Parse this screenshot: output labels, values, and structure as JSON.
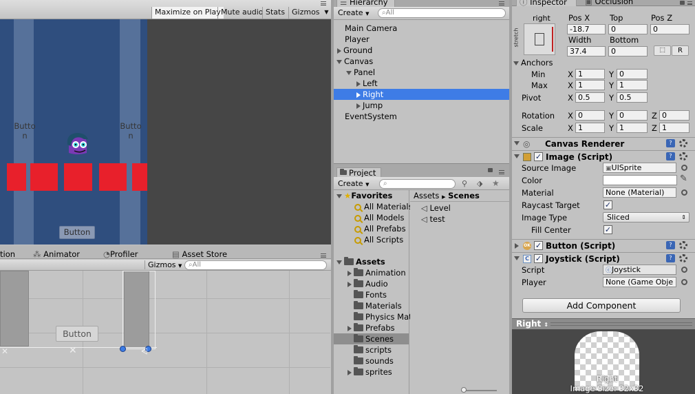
{
  "game_toolbar": {
    "maximize": "Maximize on Play",
    "mute": "Mute audio",
    "stats": "Stats",
    "gizmos": "Gizmos"
  },
  "game_view": {
    "left_button": "Butto\nn",
    "right_button": "Butto\nn",
    "bottom_button": "Button"
  },
  "scene_tabs": {
    "partial": "tion",
    "animator": "Animator",
    "profiler": "Profiler",
    "asset_store": "Asset Store",
    "gizmos": "Gizmos",
    "search_placeholder": "All"
  },
  "scene_view": {
    "button_label": "Button"
  },
  "hierarchy": {
    "tab": "Hierarchy",
    "create": "Create",
    "search_placeholder": "All",
    "items": [
      "Main Camera",
      "Player",
      "Ground",
      "Canvas",
      "Panel",
      "Left",
      "Right",
      "Jump",
      "EventSystem"
    ]
  },
  "project": {
    "tab": "Project",
    "create": "Create",
    "favorites": "Favorites",
    "fav_items": [
      "All Materials",
      "All Models",
      "All Prefabs",
      "All Scripts"
    ],
    "assets": "Assets",
    "folders": [
      "Animation",
      "Audio",
      "Fonts",
      "Materials",
      "Physics Mat",
      "Prefabs",
      "Scenes",
      "scripts",
      "sounds",
      "sprites"
    ],
    "breadcrumb_root": "Assets",
    "breadcrumb_current": "Scenes",
    "files": [
      "Level",
      "test"
    ]
  },
  "inspector": {
    "tab": "Inspector",
    "tab2": "Occlusion",
    "anchor_preset": "right",
    "stretch": "stretch",
    "posx_label": "Pos X",
    "top_label": "Top",
    "posz_label": "Pos Z",
    "posx": "-18.7",
    "top": "0",
    "posz": "0",
    "width_label": "Width",
    "bottom_label": "Bottom",
    "width": "37.4",
    "bottom": "0",
    "r_button": "R",
    "anchors": "Anchors",
    "min": "Min",
    "max": "Max",
    "pivot": "Pivot",
    "rotation": "Rotation",
    "scale": "Scale",
    "x": "X",
    "y": "Y",
    "z": "Z",
    "min_x": "1",
    "min_y": "0",
    "max_x": "1",
    "max_y": "1",
    "pivot_x": "0.5",
    "pivot_y": "0.5",
    "rot_x": "0",
    "rot_y": "0",
    "rot_z": "0",
    "scale_x": "1",
    "scale_y": "1",
    "scale_z": "1",
    "canvas_renderer": "Canvas Renderer",
    "image_script": "Image (Script)",
    "source_image": "Source Image",
    "source_value": "UISprite",
    "color": "Color",
    "material": "Material",
    "material_value": "None (Material)",
    "raycast": "Raycast Target",
    "image_type": "Image Type",
    "image_type_value": "Sliced",
    "fill_center": "Fill Center",
    "button_script": "Button (Script)",
    "joystick_script": "Joystick (Script)",
    "script": "Script",
    "script_value": "Joystick",
    "player": "Player",
    "player_value": "None (Game Obje",
    "add_component": "Add Component",
    "preview_title": "Right",
    "preview_name": "Right",
    "image_size": "Image Size: 32x32"
  }
}
